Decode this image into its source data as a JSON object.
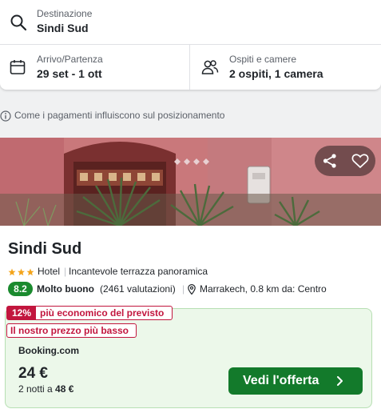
{
  "search": {
    "destination_label": "Destinazione",
    "destination_value": "Sindi Sud",
    "dates_label": "Arrivo/Partenza",
    "dates_value": "29 set - 1 ott",
    "guests_label": "Ospiti e camere",
    "guests_value": "2 ospiti, 1 camera"
  },
  "payments_note": "Come i pagamenti influiscono sul posizionamento",
  "hotel": {
    "name": "Sindi Sud",
    "stars": 3,
    "type": "Hotel",
    "feature": "Incantevole terrazza panoramica",
    "rating_score": "8.2",
    "rating_label": "Molto buono",
    "rating_count": "(2461 valutazioni)",
    "location": "Marrakech, 0.8 km da: Centro"
  },
  "deal": {
    "cheaper_pct": "12%",
    "cheaper_text": "più economico del previsto",
    "lowest_text": "Il nostro prezzo più basso",
    "provider": "Booking.com",
    "price": "24 €",
    "nights_prefix": "2 notti a",
    "nights_total": "48 €",
    "cta_label": "Vedi l'offerta"
  },
  "icons": {
    "search": "search-icon",
    "calendar": "calendar-icon",
    "guests": "guests-icon",
    "info": "info-icon",
    "share": "share-icon",
    "favorite": "heart-icon",
    "location": "location-pin-icon",
    "chevron": "chevron-right-icon"
  },
  "colors": {
    "rating_green": "#1a8a2e",
    "cta_green": "#137a2b",
    "deal_bg": "#ecf8ea",
    "badge_red": "#c2163e",
    "star_orange": "#f3a41b"
  }
}
